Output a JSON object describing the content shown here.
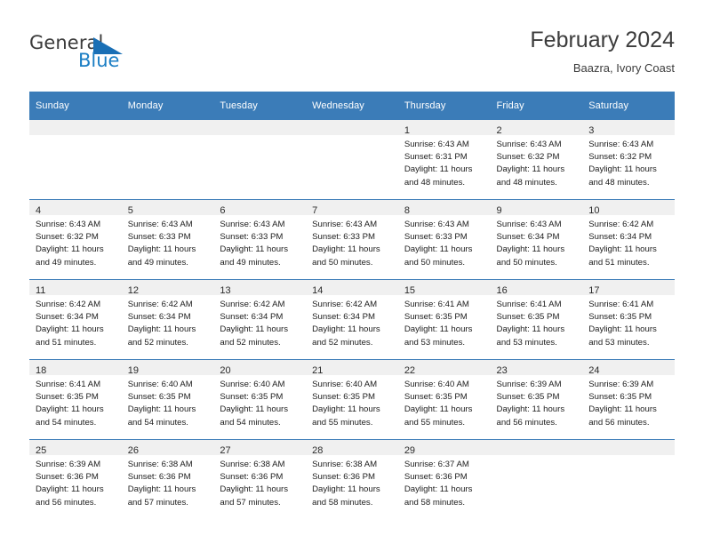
{
  "logo": {
    "text_top": "General",
    "text_bottom": "Blue",
    "triangle_color": "#1a6fb5",
    "blue_color": "#1b7ec4",
    "gray_color": "#3b3b3b"
  },
  "header": {
    "title": "February 2024",
    "subtitle": "Baazra, Ivory Coast"
  },
  "theme": {
    "header_blue": "#3b7cb8",
    "daynum_band": "#f0f0f0",
    "text": "#1c1c1c"
  },
  "calendar": {
    "weekday_headers": [
      "Sunday",
      "Monday",
      "Tuesday",
      "Wednesday",
      "Thursday",
      "Friday",
      "Saturday"
    ],
    "weeks": [
      [
        {
          "empty": true
        },
        {
          "empty": true
        },
        {
          "empty": true
        },
        {
          "empty": true
        },
        {
          "day": "1",
          "sunrise": "Sunrise: 6:43 AM",
          "sunset": "Sunset: 6:31 PM",
          "daylight_1": "Daylight: 11 hours",
          "daylight_2": "and 48 minutes."
        },
        {
          "day": "2",
          "sunrise": "Sunrise: 6:43 AM",
          "sunset": "Sunset: 6:32 PM",
          "daylight_1": "Daylight: 11 hours",
          "daylight_2": "and 48 minutes."
        },
        {
          "day": "3",
          "sunrise": "Sunrise: 6:43 AM",
          "sunset": "Sunset: 6:32 PM",
          "daylight_1": "Daylight: 11 hours",
          "daylight_2": "and 48 minutes."
        }
      ],
      [
        {
          "day": "4",
          "sunrise": "Sunrise: 6:43 AM",
          "sunset": "Sunset: 6:32 PM",
          "daylight_1": "Daylight: 11 hours",
          "daylight_2": "and 49 minutes."
        },
        {
          "day": "5",
          "sunrise": "Sunrise: 6:43 AM",
          "sunset": "Sunset: 6:33 PM",
          "daylight_1": "Daylight: 11 hours",
          "daylight_2": "and 49 minutes."
        },
        {
          "day": "6",
          "sunrise": "Sunrise: 6:43 AM",
          "sunset": "Sunset: 6:33 PM",
          "daylight_1": "Daylight: 11 hours",
          "daylight_2": "and 49 minutes."
        },
        {
          "day": "7",
          "sunrise": "Sunrise: 6:43 AM",
          "sunset": "Sunset: 6:33 PM",
          "daylight_1": "Daylight: 11 hours",
          "daylight_2": "and 50 minutes."
        },
        {
          "day": "8",
          "sunrise": "Sunrise: 6:43 AM",
          "sunset": "Sunset: 6:33 PM",
          "daylight_1": "Daylight: 11 hours",
          "daylight_2": "and 50 minutes."
        },
        {
          "day": "9",
          "sunrise": "Sunrise: 6:43 AM",
          "sunset": "Sunset: 6:34 PM",
          "daylight_1": "Daylight: 11 hours",
          "daylight_2": "and 50 minutes."
        },
        {
          "day": "10",
          "sunrise": "Sunrise: 6:42 AM",
          "sunset": "Sunset: 6:34 PM",
          "daylight_1": "Daylight: 11 hours",
          "daylight_2": "and 51 minutes."
        }
      ],
      [
        {
          "day": "11",
          "sunrise": "Sunrise: 6:42 AM",
          "sunset": "Sunset: 6:34 PM",
          "daylight_1": "Daylight: 11 hours",
          "daylight_2": "and 51 minutes."
        },
        {
          "day": "12",
          "sunrise": "Sunrise: 6:42 AM",
          "sunset": "Sunset: 6:34 PM",
          "daylight_1": "Daylight: 11 hours",
          "daylight_2": "and 52 minutes."
        },
        {
          "day": "13",
          "sunrise": "Sunrise: 6:42 AM",
          "sunset": "Sunset: 6:34 PM",
          "daylight_1": "Daylight: 11 hours",
          "daylight_2": "and 52 minutes."
        },
        {
          "day": "14",
          "sunrise": "Sunrise: 6:42 AM",
          "sunset": "Sunset: 6:34 PM",
          "daylight_1": "Daylight: 11 hours",
          "daylight_2": "and 52 minutes."
        },
        {
          "day": "15",
          "sunrise": "Sunrise: 6:41 AM",
          "sunset": "Sunset: 6:35 PM",
          "daylight_1": "Daylight: 11 hours",
          "daylight_2": "and 53 minutes."
        },
        {
          "day": "16",
          "sunrise": "Sunrise: 6:41 AM",
          "sunset": "Sunset: 6:35 PM",
          "daylight_1": "Daylight: 11 hours",
          "daylight_2": "and 53 minutes."
        },
        {
          "day": "17",
          "sunrise": "Sunrise: 6:41 AM",
          "sunset": "Sunset: 6:35 PM",
          "daylight_1": "Daylight: 11 hours",
          "daylight_2": "and 53 minutes."
        }
      ],
      [
        {
          "day": "18",
          "sunrise": "Sunrise: 6:41 AM",
          "sunset": "Sunset: 6:35 PM",
          "daylight_1": "Daylight: 11 hours",
          "daylight_2": "and 54 minutes."
        },
        {
          "day": "19",
          "sunrise": "Sunrise: 6:40 AM",
          "sunset": "Sunset: 6:35 PM",
          "daylight_1": "Daylight: 11 hours",
          "daylight_2": "and 54 minutes."
        },
        {
          "day": "20",
          "sunrise": "Sunrise: 6:40 AM",
          "sunset": "Sunset: 6:35 PM",
          "daylight_1": "Daylight: 11 hours",
          "daylight_2": "and 54 minutes."
        },
        {
          "day": "21",
          "sunrise": "Sunrise: 6:40 AM",
          "sunset": "Sunset: 6:35 PM",
          "daylight_1": "Daylight: 11 hours",
          "daylight_2": "and 55 minutes."
        },
        {
          "day": "22",
          "sunrise": "Sunrise: 6:40 AM",
          "sunset": "Sunset: 6:35 PM",
          "daylight_1": "Daylight: 11 hours",
          "daylight_2": "and 55 minutes."
        },
        {
          "day": "23",
          "sunrise": "Sunrise: 6:39 AM",
          "sunset": "Sunset: 6:35 PM",
          "daylight_1": "Daylight: 11 hours",
          "daylight_2": "and 56 minutes."
        },
        {
          "day": "24",
          "sunrise": "Sunrise: 6:39 AM",
          "sunset": "Sunset: 6:35 PM",
          "daylight_1": "Daylight: 11 hours",
          "daylight_2": "and 56 minutes."
        }
      ],
      [
        {
          "day": "25",
          "sunrise": "Sunrise: 6:39 AM",
          "sunset": "Sunset: 6:36 PM",
          "daylight_1": "Daylight: 11 hours",
          "daylight_2": "and 56 minutes."
        },
        {
          "day": "26",
          "sunrise": "Sunrise: 6:38 AM",
          "sunset": "Sunset: 6:36 PM",
          "daylight_1": "Daylight: 11 hours",
          "daylight_2": "and 57 minutes."
        },
        {
          "day": "27",
          "sunrise": "Sunrise: 6:38 AM",
          "sunset": "Sunset: 6:36 PM",
          "daylight_1": "Daylight: 11 hours",
          "daylight_2": "and 57 minutes."
        },
        {
          "day": "28",
          "sunrise": "Sunrise: 6:38 AM",
          "sunset": "Sunset: 6:36 PM",
          "daylight_1": "Daylight: 11 hours",
          "daylight_2": "and 58 minutes."
        },
        {
          "day": "29",
          "sunrise": "Sunrise: 6:37 AM",
          "sunset": "Sunset: 6:36 PM",
          "daylight_1": "Daylight: 11 hours",
          "daylight_2": "and 58 minutes."
        },
        {
          "empty": true
        },
        {
          "empty": true
        }
      ]
    ]
  }
}
